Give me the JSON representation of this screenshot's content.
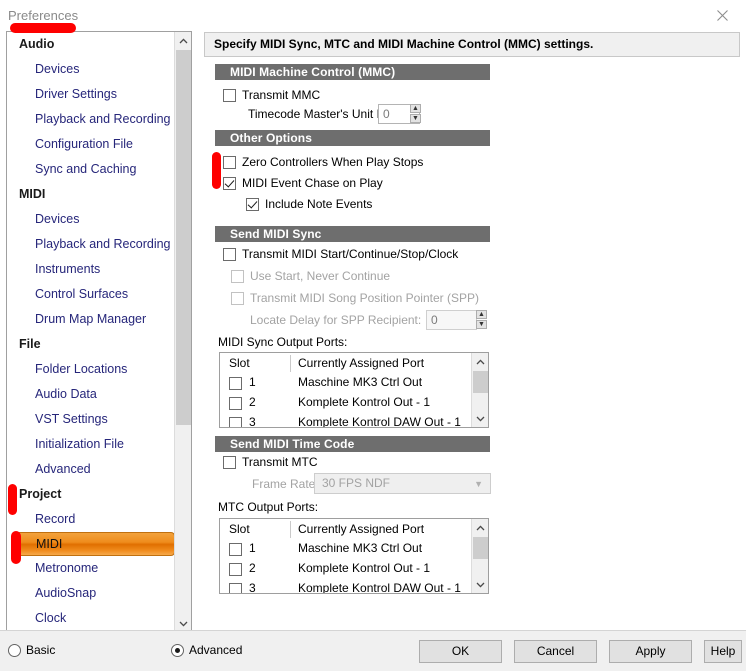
{
  "window": {
    "title": "Preferences",
    "close_icon": "close-icon"
  },
  "sidebar": {
    "scroll_up_icon": "chevron-up-icon",
    "scroll_down_icon": "chevron-down-icon",
    "items": [
      {
        "label": "Audio",
        "type": "group"
      },
      {
        "label": "Devices",
        "type": "item"
      },
      {
        "label": "Driver Settings",
        "type": "item"
      },
      {
        "label": "Playback and Recording",
        "type": "item"
      },
      {
        "label": "Configuration File",
        "type": "item"
      },
      {
        "label": "Sync and Caching",
        "type": "item"
      },
      {
        "label": "MIDI",
        "type": "group"
      },
      {
        "label": "Devices",
        "type": "item"
      },
      {
        "label": "Playback and Recording",
        "type": "item"
      },
      {
        "label": "Instruments",
        "type": "item"
      },
      {
        "label": "Control Surfaces",
        "type": "item"
      },
      {
        "label": "Drum Map Manager",
        "type": "item"
      },
      {
        "label": "File",
        "type": "group"
      },
      {
        "label": "Folder Locations",
        "type": "item"
      },
      {
        "label": "Audio Data",
        "type": "item"
      },
      {
        "label": "VST Settings",
        "type": "item"
      },
      {
        "label": "Initialization File",
        "type": "item"
      },
      {
        "label": "Advanced",
        "type": "item"
      },
      {
        "label": "Project",
        "type": "group"
      },
      {
        "label": "Record",
        "type": "item"
      },
      {
        "label": "MIDI",
        "type": "item",
        "selected": true
      },
      {
        "label": "Metronome",
        "type": "item"
      },
      {
        "label": "AudioSnap",
        "type": "item"
      },
      {
        "label": "Clock",
        "type": "item"
      }
    ]
  },
  "main": {
    "description": "Specify MIDI Sync, MTC and MIDI Machine Control (MMC) settings.",
    "sections": {
      "mmc": {
        "header": "MIDI Machine Control (MMC)",
        "transmit_mmc_label": "Transmit MMC",
        "unit_id_label": "Timecode Master's Unit ID:",
        "unit_id_value": "0"
      },
      "other_options": {
        "header": "Other Options",
        "zero_controllers_label": "Zero Controllers When Play Stops",
        "chase_label": "MIDI Event Chase on Play",
        "include_note_label": "Include Note Events"
      },
      "send_midi_sync": {
        "header": "Send MIDI Sync",
        "transmit_clock_label": "Transmit MIDI Start/Continue/Stop/Clock",
        "use_start_label": "Use Start, Never Continue",
        "transmit_spp_label": "Transmit MIDI Song Position Pointer (SPP)",
        "locate_delay_label": "Locate Delay for SPP Recipient:",
        "locate_delay_value": "0",
        "ports_label": "MIDI Sync Output Ports:"
      },
      "send_mtc": {
        "header": "Send MIDI Time Code",
        "transmit_mtc_label": "Transmit MTC",
        "frame_rate_label": "Frame Rate:",
        "frame_rate_value": "30 FPS NDF",
        "ports_label": "MTC Output Ports:"
      }
    },
    "port_table": {
      "col_slot": "Slot",
      "col_port": "Currently Assigned Port",
      "rows": [
        {
          "slot": "1",
          "port": "Maschine MK3 Ctrl Out"
        },
        {
          "slot": "2",
          "port": "Komplete Kontrol Out - 1"
        },
        {
          "slot": "3",
          "port": "Komplete Kontrol DAW Out - 1"
        }
      ]
    }
  },
  "footer": {
    "basic_label": "Basic",
    "advanced_label": "Advanced",
    "ok_label": "OK",
    "cancel_label": "Cancel",
    "apply_label": "Apply",
    "help_label": "Help"
  },
  "colors": {
    "selection_orange": "#e06f00",
    "section_header_gray": "#6e6e6e",
    "annotation_red": "#fe0000",
    "link_blue": "#26267a"
  }
}
